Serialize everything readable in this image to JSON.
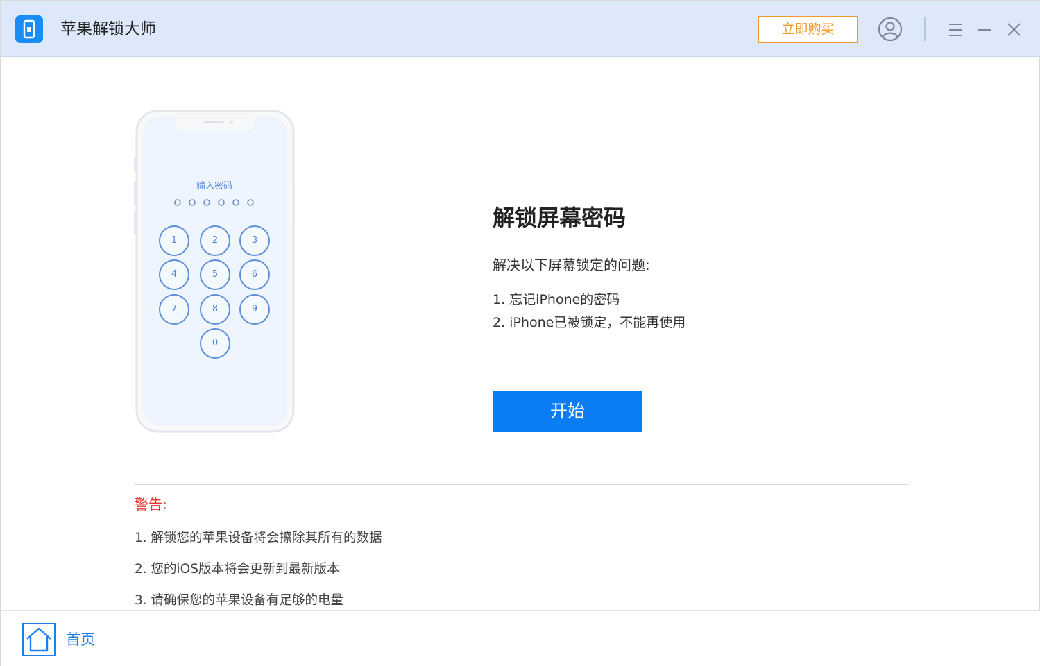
{
  "window": {
    "title": "苹果解锁大师",
    "buy_label": "立即购买"
  },
  "phone": {
    "prompt": "输入密码",
    "keys": [
      "1",
      "2",
      "3",
      "4",
      "5",
      "6",
      "7",
      "8",
      "9",
      "0"
    ]
  },
  "main": {
    "title": "解锁屏幕密码",
    "subtitle": "解决以下屏幕锁定的问题:",
    "items": [
      "1. 忘记iPhone的密码",
      "2. iPhone已被锁定，不能再使用"
    ],
    "start_label": "开始"
  },
  "warning": {
    "title": "警告:",
    "items": [
      "1. 解锁您的苹果设备将会擦除其所有的数据",
      "2. 您的iOS版本将会更新到最新版本",
      "3. 请确保您的苹果设备有足够的电量"
    ]
  },
  "footer": {
    "home_label": "首页"
  },
  "icons": {
    "app": "phone-lock-app-icon",
    "account": "user-circle-icon",
    "menu": "menu-icon",
    "minimize": "minimize-icon",
    "close": "close-icon",
    "home": "home-icon"
  },
  "colors": {
    "accent": "#0a7cf4",
    "buy": "#f39a2b",
    "warning": "#e83030",
    "titlebar": "#dde9fb"
  }
}
